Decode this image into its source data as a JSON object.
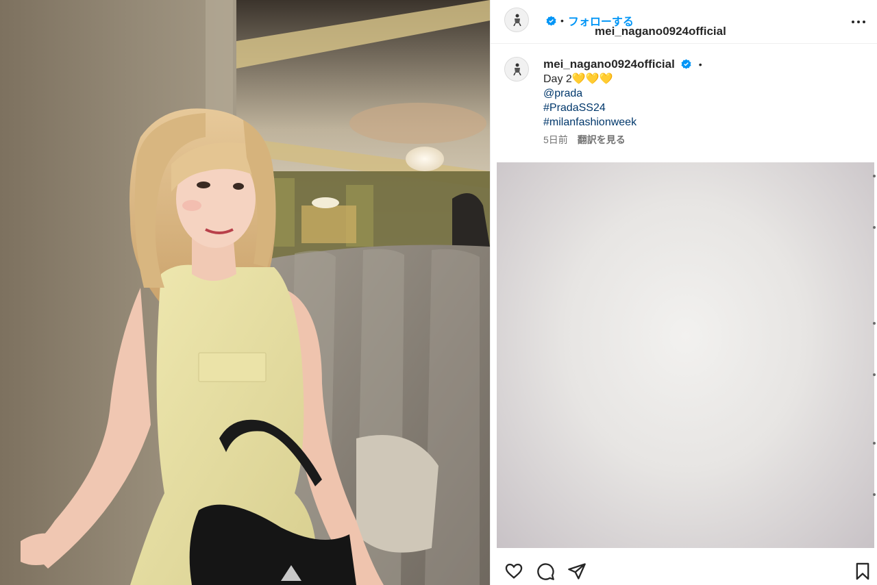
{
  "post": {
    "username": "mei_nagano0924official",
    "separator": "•",
    "follow_label": "フォローする",
    "caption_lines": [
      "Day 2💛💛💛"
    ],
    "mention": "@prada",
    "hashtags": [
      "#PradaSS24",
      "#milanfashionweek"
    ],
    "timestamp": "5日前",
    "translate_label": "翻訳を見る"
  },
  "icons": {
    "verified": "verified-badge-icon",
    "more": "more-options-icon",
    "like": "heart-icon",
    "comment": "comment-icon",
    "share": "send-icon",
    "save": "bookmark-icon"
  },
  "colors": {
    "follow": "#0095f6",
    "link": "#00376b",
    "verified": "#0095f6",
    "muted": "#737373"
  }
}
